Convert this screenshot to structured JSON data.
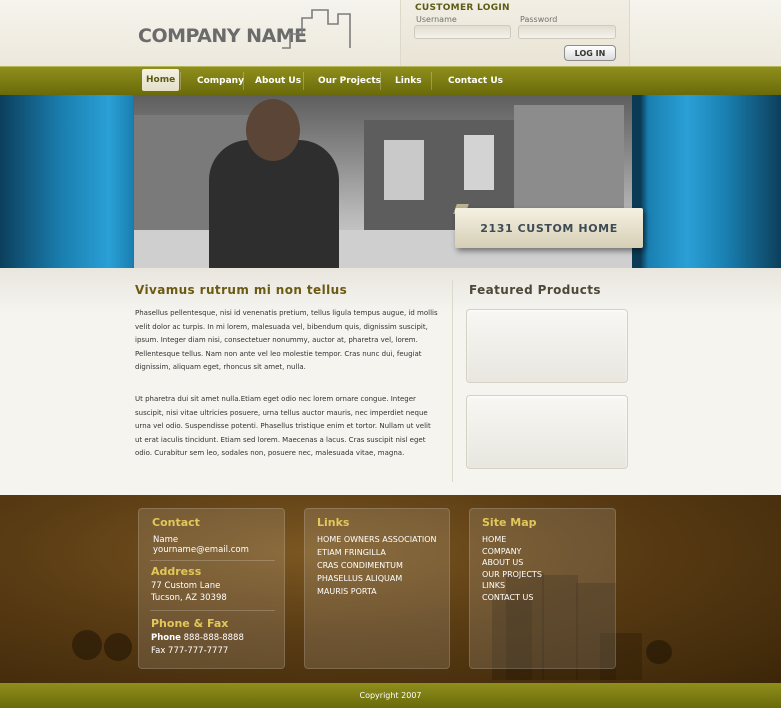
{
  "header": {
    "logo_text": "COMPANY NAME",
    "login": {
      "title": "CUSTOMER LOGIN",
      "username_label": "Username",
      "password_label": "Password",
      "button": "LOG IN"
    }
  },
  "nav": {
    "items": [
      "Home",
      "Company",
      "About Us",
      "Our Projects",
      "Links",
      "Contact Us"
    ],
    "active": "Home"
  },
  "banner": {
    "tag": "2131 CUSTOM HOME"
  },
  "main": {
    "title": "Vivamus rutrum mi non tellus",
    "paragraph1": "Phasellus pellentesque, nisi id venenatis pretium, tellus ligula tempus augue, id mollis velit dolor ac turpis. In mi lorem, malesuada vel, bibendum quis, dignissim suscipit, ipsum. Integer diam nisi, consectetuer nonummy, auctor at, pharetra vel, lorem. Pellentesque tellus. Nam non ante vel leo molestie tempor. Cras nunc dui, feugiat dignissim, aliquam eget, rhoncus sit amet, nulla.",
    "paragraph2": "Ut pharetra dui sit amet nulla.Etiam eget odio nec lorem ornare congue. Integer suscipit, nisi vitae ultricies posuere, urna tellus auctor mauris, nec imperdiet neque urna vel odio. Suspendisse potenti. Phasellus tristique enim et tortor. Nullam ut velit ut erat iaculis tincidunt. Etiam sed lorem. Maecenas a lacus. Cras suscipit nisl eget odio. Curabitur sem leo, sodales non, posuere nec, malesuada vitae, magna."
  },
  "featured": {
    "title": "Featured Products"
  },
  "footer": {
    "contact": {
      "heading": "Contact",
      "name": "Name",
      "email": "yourname@email.com",
      "address_heading": "Address",
      "address_line1": "77 Custom Lane",
      "address_line2": "Tucson, AZ 30398",
      "phone_heading": "Phone & Fax",
      "phone_label": "Phone",
      "phone_number": "888-888-8888",
      "fax": "Fax 777-777-7777"
    },
    "links": {
      "heading": "Links",
      "items": [
        "HOME OWNERS ASSOCIATION",
        "ETIAM FRINGILLA",
        "CRAS CONDIMENTUM",
        "PHASELLUS ALIQUAM",
        "MAURIS PORTA"
      ]
    },
    "sitemap": {
      "heading": "Site Map",
      "items": [
        "HOME",
        "COMPANY",
        "ABOUT US",
        "OUR PROJECTS",
        "LINKS",
        "CONTACT US"
      ]
    },
    "copyright": "Copyright 2007"
  },
  "colors": {
    "nav_olive": "#7b7b14",
    "heading_brown": "#6b5a12",
    "footer_heading": "#e2c85a",
    "banner_blue": "#2aa0d6"
  }
}
